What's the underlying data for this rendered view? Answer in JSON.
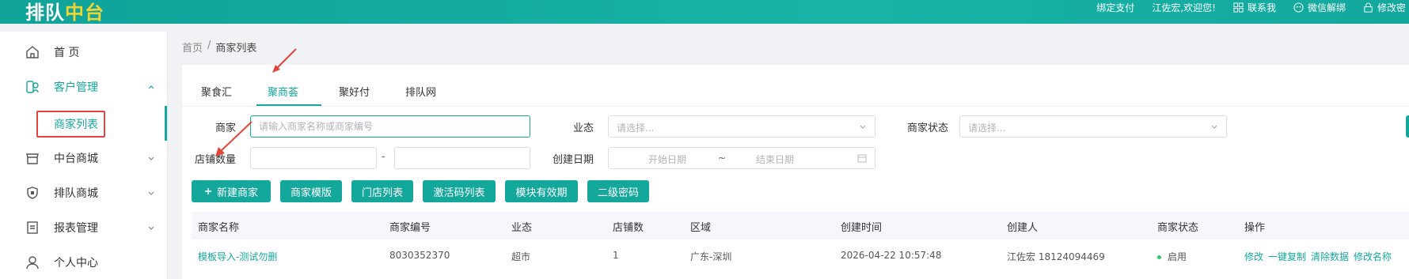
{
  "app": {
    "logo": "排队",
    "logo_accent": "中台",
    "top_links": {
      "bind_pay": "绑定支付",
      "welcome": "江佐宏,欢迎您!",
      "contact": "联系我",
      "wechat_unbind": "微信解绑",
      "change_pwd": "修改密"
    }
  },
  "sidebar": {
    "items": [
      {
        "label": "首 页",
        "icon": "home-icon"
      },
      {
        "label": "客户管理",
        "icon": "customer-icon",
        "expanded": true
      },
      {
        "label": "中台商城",
        "icon": "store-icon"
      },
      {
        "label": "排队商城",
        "icon": "shield-icon"
      },
      {
        "label": "报表管理",
        "icon": "report-icon"
      },
      {
        "label": "个人中心",
        "icon": "user-icon"
      }
    ],
    "sub_item": "商家列表"
  },
  "breadcrumb": {
    "home": "首页",
    "sep": "/",
    "current": "商家列表"
  },
  "tabs": [
    "聚食汇",
    "聚商荟",
    "聚好付",
    "排队网"
  ],
  "active_tab_index": 1,
  "filters": {
    "merchant_label": "商家",
    "merchant_placeholder": "请输入商家名称或商家编号",
    "business_label": "业态",
    "business_placeholder": "请选择...",
    "status_label": "商家状态",
    "status_placeholder": "请选择...",
    "store_count_label": "店铺数量",
    "range_dash": "-",
    "created_label": "创建日期",
    "start_date": "开始日期",
    "date_sep": "~",
    "end_date": "结束日期"
  },
  "buttons": {
    "new_merchant": "新建商家",
    "template": "商家模版",
    "store_list": "门店列表",
    "activation_codes": "激活码列表",
    "module_validity": "模块有效期",
    "secondary_pwd": "二级密码"
  },
  "table": {
    "headers": [
      "商家名称",
      "商家编号",
      "业态",
      "店铺数",
      "区域",
      "创建时间",
      "创建人",
      "商家状态",
      "操作"
    ],
    "rows": [
      {
        "name": "模板导入-测试勿删",
        "code": "8030352370",
        "business": "超市",
        "stores": "1",
        "region": "广东-深圳",
        "created": "2026-04-22 10:57:48",
        "creator": "江佐宏 18124094469",
        "status": "启用",
        "ops": [
          "修改",
          "一键复制",
          "清除数据",
          "修改名称"
        ]
      }
    ]
  },
  "colors": {
    "primary": "#14a89d",
    "highlight": "#e5443c"
  }
}
